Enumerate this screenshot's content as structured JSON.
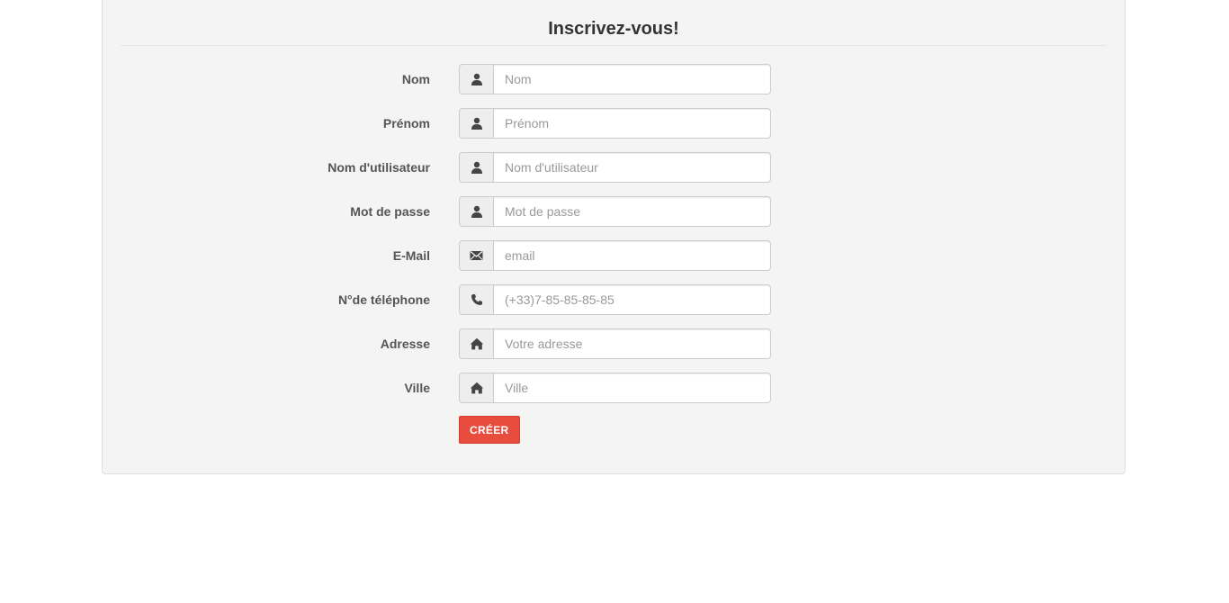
{
  "form": {
    "title": "Inscrivez-vous!",
    "submit_label": "CRÉER",
    "submit_color": "#e74c3c",
    "fields": [
      {
        "label": "Nom",
        "placeholder": "Nom",
        "icon": "user-icon"
      },
      {
        "label": "Prénom",
        "placeholder": "Prénom",
        "icon": "user-icon"
      },
      {
        "label": "Nom d'utilisateur",
        "placeholder": "Nom d'utilisateur",
        "icon": "user-icon"
      },
      {
        "label": "Mot de passe",
        "placeholder": "Mot de passe",
        "icon": "user-icon"
      },
      {
        "label": "E-Mail",
        "placeholder": "email",
        "icon": "envelope-icon"
      },
      {
        "label": "N°de téléphone",
        "placeholder": "(+33)7-85-85-85-85",
        "icon": "phone-icon"
      },
      {
        "label": "Adresse",
        "placeholder": "Votre adresse",
        "icon": "home-icon"
      },
      {
        "label": "Ville",
        "placeholder": "Ville",
        "icon": "home-icon"
      }
    ]
  }
}
